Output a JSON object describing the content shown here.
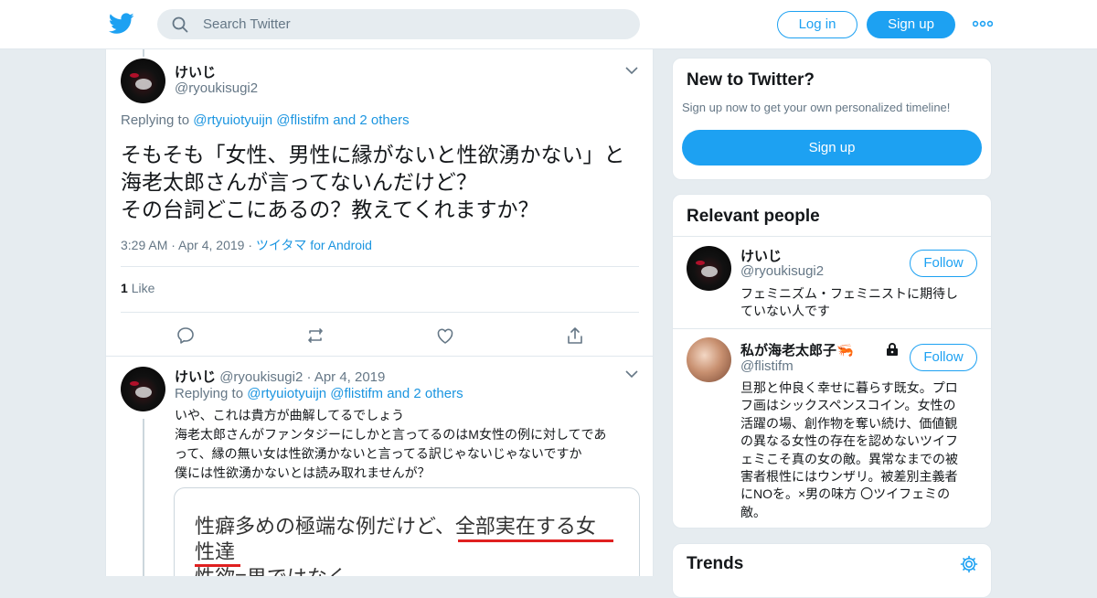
{
  "colors": {
    "accent": "#1da1f2",
    "link": "#1b95e0",
    "muted": "#657786",
    "background": "#e6ecf0",
    "underline": "#e02020"
  },
  "header": {
    "logo_icon": "twitter-bird-icon",
    "search": {
      "placeholder": "Search Twitter"
    },
    "login_label": "Log in",
    "signup_label": "Sign up",
    "more_icon": "more-dots-icon"
  },
  "main_tweet": {
    "name": "けいじ",
    "handle": "@ryoukisugi2",
    "replying_label": "Replying to",
    "replying_users": "@rtyuiotyuijn @flistifm and 2 others",
    "text_lines": [
      "そもそも「女性、男性に縁がないと性欲湧かない」と",
      "海老太郎さんが言ってないんだけど？",
      "その台詞どこにあるの？教えてくれますか？"
    ],
    "time": "3:29 AM",
    "date": "Apr 4, 2019",
    "source": "ツイタマ for Android",
    "like_count": "1",
    "like_label": "Like"
  },
  "reply_tweet": {
    "name": "けいじ",
    "handle": "@ryoukisugi2",
    "date": "Apr 4, 2019",
    "replying_label": "Replying to",
    "replying_users": "@rtyuiotyuijn @flistifm and 2 others",
    "text_lines": [
      "いや、これは貴方が曲解してるでしょう",
      "海老太郎さんがファンタジーにしかと言ってるのはM女性の例に対してであ",
      "って、縁の無い女は性欲湧かないと言ってる訳じゃないじゃないですか",
      "僕には性欲湧かないとは読み取れませんが？"
    ],
    "image_text_lines": [
      "性癖多めの極端な例だけど、全部実在する女",
      "性達",
      "性欲=男ではなく"
    ]
  },
  "sidebar": {
    "new_card": {
      "title": "New to Twitter?",
      "subtitle": "Sign up now to get your own personalized timeline!",
      "signup_label": "Sign up"
    },
    "relevant": {
      "title": "Relevant people",
      "people": [
        {
          "name": "けいじ",
          "handle": "@ryoukisugi2",
          "follow_label": "Follow",
          "bio_lines": [
            "フェミニズム・フェミニストに期待し",
            "ていない人です"
          ]
        },
        {
          "name": "私が海老太郎子🦐",
          "handle": "@flistifm",
          "follow_label": "Follow",
          "bio_lines": [
            "旦那と仲良く幸せに暮らす既女。プロ",
            "フ画はシックスペンスコイン。女性の",
            "活躍の場、創作物を奪い続け、価値観",
            "の異なる女性の存在を認めないツイフ",
            "ェミこそ真の女の敵。異常なまでの被",
            "害者根性にはウンザリ。被差別主義者",
            "にNOを。×男の味方 〇ツイフェミの",
            "敵。"
          ]
        }
      ]
    },
    "trends": {
      "title": "Trends",
      "settings_icon": "gear-icon"
    }
  }
}
